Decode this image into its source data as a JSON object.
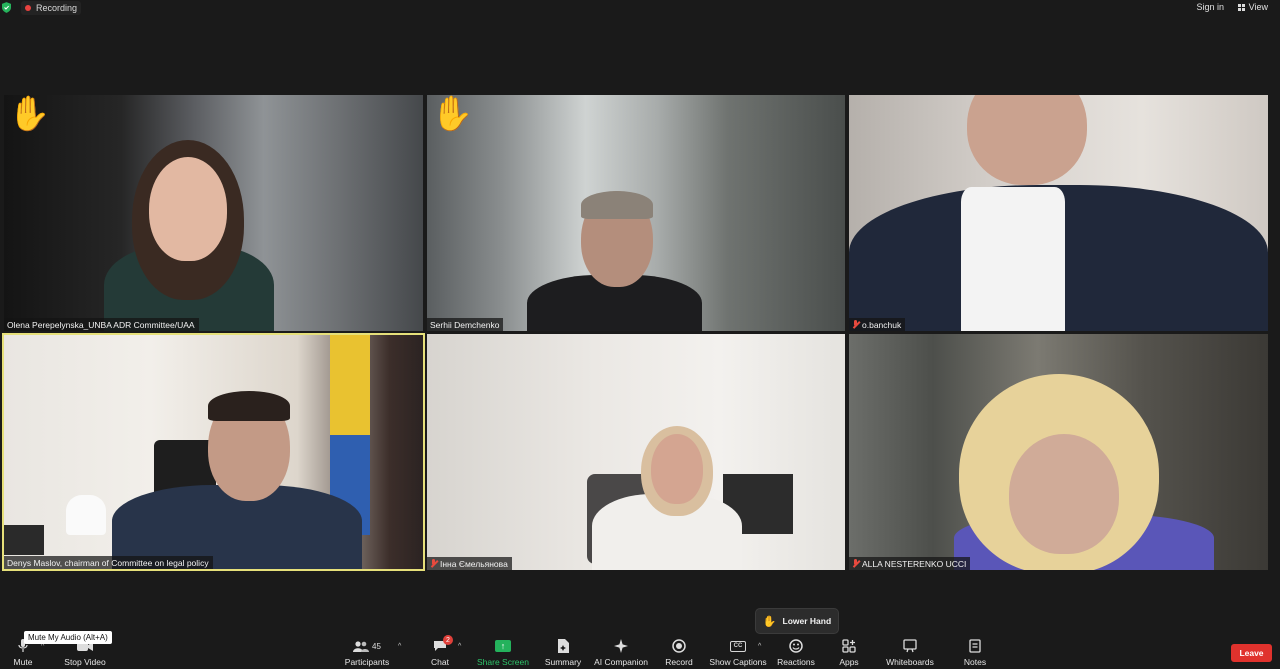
{
  "topbar": {
    "recording_label": "Recording",
    "sign_in_label": "Sign in",
    "view_label": "View"
  },
  "participants": [
    {
      "name": "Olena Perepelynska_UNBA ADR Committee/UAA",
      "hand_raised": true,
      "muted": false,
      "active_speaker": false
    },
    {
      "name": "Serhii Demchenko",
      "hand_raised": true,
      "muted": false,
      "active_speaker": false
    },
    {
      "name": "o.banchuk",
      "hand_raised": false,
      "muted": true,
      "active_speaker": false
    },
    {
      "name": "Denys Maslov, chairman of Committee on legal policy",
      "hand_raised": false,
      "muted": false,
      "active_speaker": true
    },
    {
      "name": "Інна Ємельянова",
      "hand_raised": false,
      "muted": true,
      "active_speaker": false
    },
    {
      "name": "ALLA NESTERENKO UCCI",
      "hand_raised": false,
      "muted": true,
      "active_speaker": false
    }
  ],
  "popup": {
    "lower_hand_label": "Lower Hand"
  },
  "tooltip": {
    "text": "Mute My Audio (Alt+A)"
  },
  "toolbar": {
    "mute_label": "Mute",
    "stop_video_label": "Stop Video",
    "participants_label": "Participants",
    "participants_count": "45",
    "chat_label": "Chat",
    "chat_badge": "2",
    "share_screen_label": "Share Screen",
    "summary_label": "Summary",
    "ai_companion_label": "AI Companion",
    "record_label": "Record",
    "show_captions_label": "Show Captions",
    "reactions_label": "Reactions",
    "apps_label": "Apps",
    "whiteboards_label": "Whiteboards",
    "notes_label": "Notes",
    "leave_label": "Leave"
  },
  "colors": {
    "background": "#1a1a1a",
    "active_speaker_border": "#e6e07a",
    "share_green": "#24b25c",
    "leave_red": "#e0322d",
    "recording_red": "#e8423f",
    "hand_yellow": "#f3c232"
  }
}
